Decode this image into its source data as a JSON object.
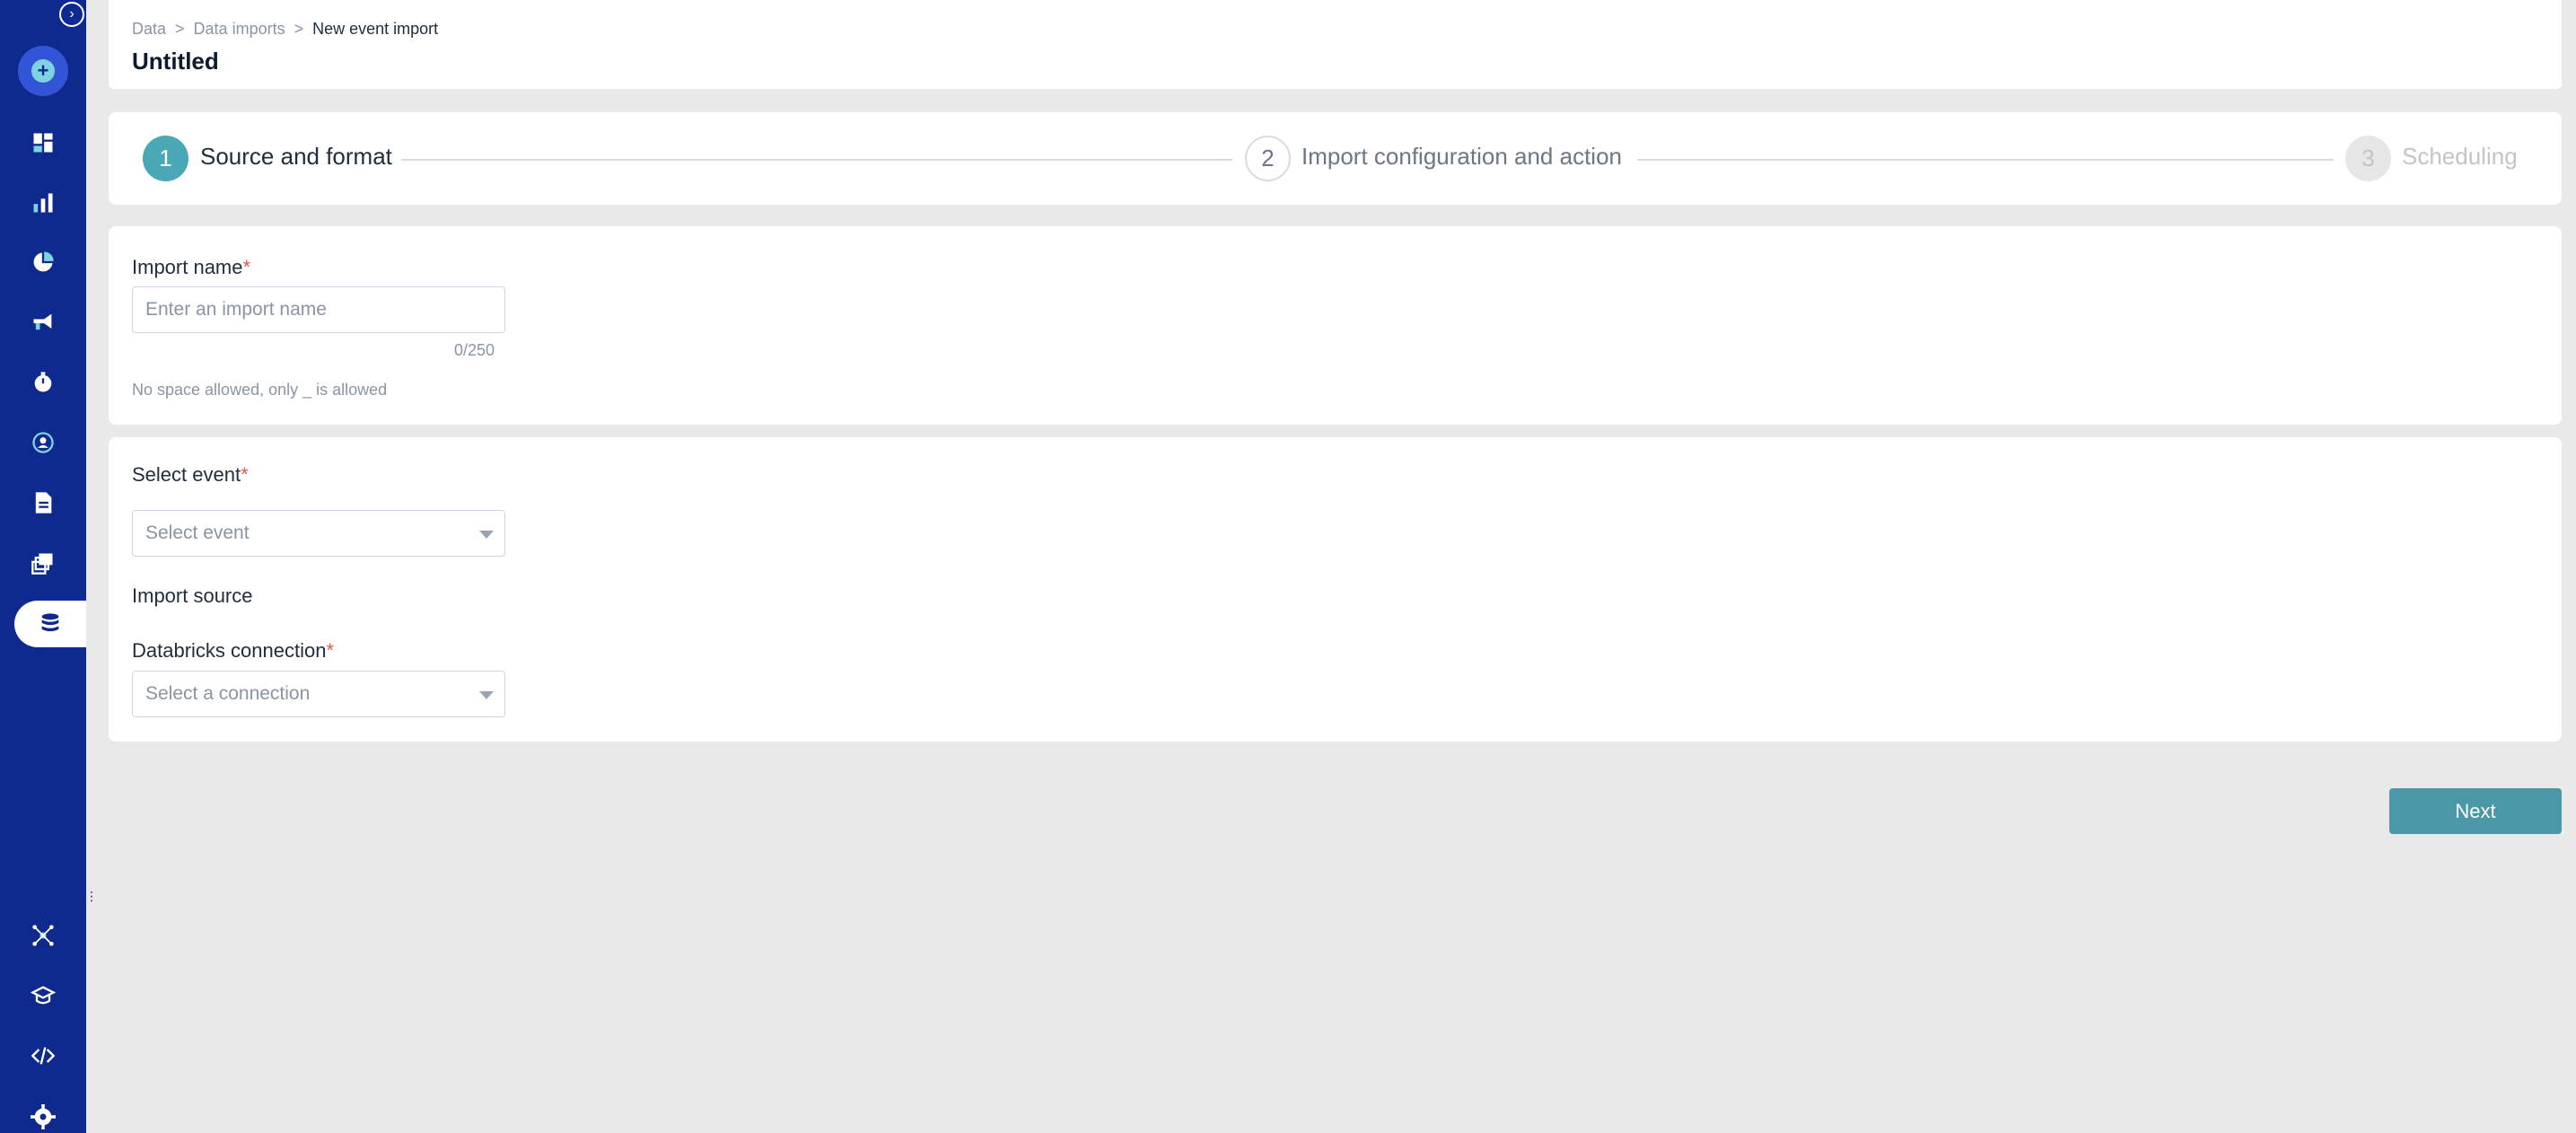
{
  "sidebar": {
    "collapse_icon": "chevron-right-circle-icon",
    "create_icon": "plus-circle-icon",
    "items": [
      {
        "icon": "dashboard-icon"
      },
      {
        "icon": "bar-chart-icon"
      },
      {
        "icon": "pie-chart-icon"
      },
      {
        "icon": "megaphone-icon"
      },
      {
        "icon": "stopwatch-icon"
      },
      {
        "icon": "user-target-icon"
      },
      {
        "icon": "document-icon"
      },
      {
        "icon": "layers-icon"
      },
      {
        "icon": "database-icon",
        "active": true
      }
    ],
    "bottom_items": [
      {
        "icon": "network-icon"
      },
      {
        "icon": "graduation-cap-icon"
      },
      {
        "icon": "code-icon"
      },
      {
        "icon": "gear-icon"
      }
    ]
  },
  "header": {
    "breadcrumb": [
      "Data",
      "Data imports",
      "New event import"
    ],
    "separator": ">",
    "title": "Untitled"
  },
  "stepper": {
    "steps": [
      {
        "number": "1",
        "label": "Source and format",
        "state": "active"
      },
      {
        "number": "2",
        "label": "Import configuration and action",
        "state": "pending"
      },
      {
        "number": "3",
        "label": "Scheduling",
        "state": "disabled"
      }
    ]
  },
  "form": {
    "import_name": {
      "label": "Import name",
      "required_mark": "*",
      "placeholder": "Enter an import name",
      "value": "",
      "counter": "0/250",
      "hint": "No space allowed, only _ is allowed"
    },
    "select_event": {
      "label": "Select event",
      "required_mark": "*",
      "placeholder": "Select event"
    },
    "import_source": {
      "label": "Import source"
    },
    "databricks_connection": {
      "label": "Databricks connection",
      "required_mark": "*",
      "placeholder": "Select a connection"
    }
  },
  "actions": {
    "next_label": "Next"
  },
  "colors": {
    "sidebar": "#0f2a8f",
    "accent": "#4aa7b6",
    "button": "#4a97a8",
    "required": "#e05a4f"
  }
}
